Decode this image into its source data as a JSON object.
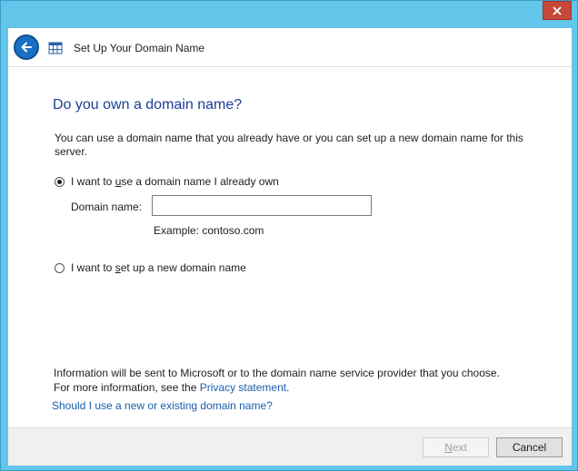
{
  "window": {
    "close_label": "✕"
  },
  "header": {
    "title": "Set Up Your Domain Name"
  },
  "main": {
    "heading": "Do you own a domain name?",
    "intro": "You can use a domain name that you already have or you can set up a new domain name for this server.",
    "option_existing": {
      "prefix": "I want to ",
      "accel": "u",
      "suffix": "se a domain name I already own",
      "checked": true
    },
    "domain_field": {
      "label": "Domain name:",
      "value": "",
      "example": "Example: contoso.com"
    },
    "option_new": {
      "prefix": "I want to ",
      "accel": "s",
      "suffix": "et up a new domain name",
      "checked": false
    },
    "info_line1": "Information will be sent to Microsoft or to the domain name service provider that you choose.",
    "info_line2_prefix": "For more information, see the ",
    "privacy_link": "Privacy statement",
    "info_line2_suffix": ".",
    "help_link": "Should I use a new or existing domain name?"
  },
  "footer": {
    "next_accel": "N",
    "next_rest": "ext",
    "next_enabled": false,
    "cancel_label": "Cancel"
  },
  "colors": {
    "frame": "#62c5ea",
    "heading": "#1c3f94",
    "link": "#1a5dab",
    "close": "#c7483a"
  },
  "icons": [
    "close-icon",
    "back-arrow-icon",
    "app-grid-icon"
  ]
}
